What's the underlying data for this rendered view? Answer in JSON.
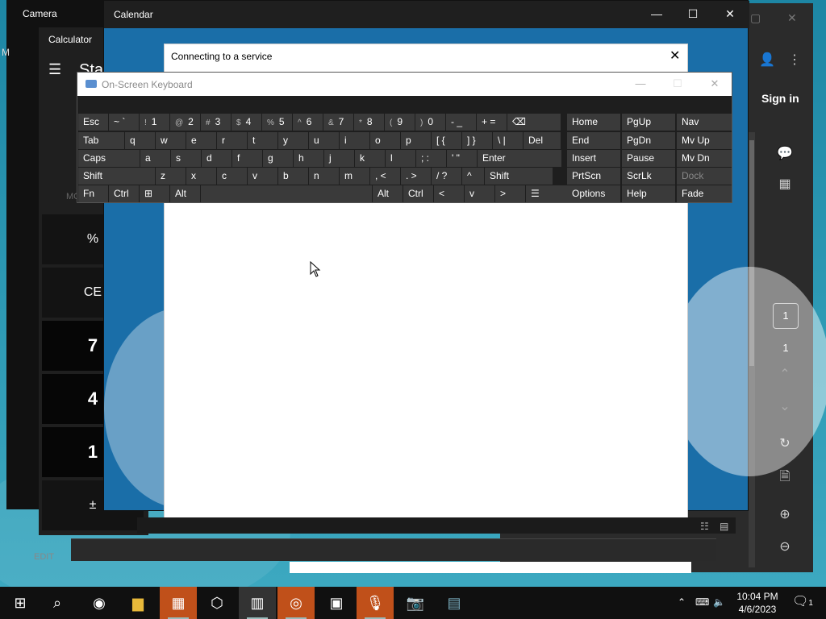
{
  "reader": {
    "sign_in": "Sign in",
    "page_box": "1",
    "page_num": "1"
  },
  "camera": {
    "title": "Camera",
    "letter": "M"
  },
  "calculator": {
    "title": "Calculator",
    "mode": "Sta",
    "mem_label": "MC",
    "keys": [
      "%",
      "CE",
      "7",
      "4",
      "1",
      "±"
    ],
    "edit_label": "EDIT"
  },
  "calendar": {
    "title": "Calendar"
  },
  "dialog": {
    "title": "Connecting to a service"
  },
  "osk": {
    "title": "On-Screen Keyboard",
    "row1": [
      {
        "l": "Esc"
      },
      {
        "l": "~ `"
      },
      {
        "s": "!",
        "l": "1"
      },
      {
        "s": "@",
        "l": "2"
      },
      {
        "s": "#",
        "l": "3"
      },
      {
        "s": "$",
        "l": "4"
      },
      {
        "s": "%",
        "l": "5"
      },
      {
        "s": "^",
        "l": "6"
      },
      {
        "s": "&",
        "l": "7"
      },
      {
        "s": "*",
        "l": "8"
      },
      {
        "s": "(",
        "l": "9"
      },
      {
        "s": ")",
        "l": "0"
      },
      {
        "l": "- _"
      },
      {
        "l": "+ ="
      },
      {
        "l": "⌫"
      }
    ],
    "row2": [
      "Tab",
      "q",
      "w",
      "e",
      "r",
      "t",
      "y",
      "u",
      "i",
      "o",
      "p",
      "[ {",
      "] }",
      "\\ |",
      "Del"
    ],
    "row3": [
      "Caps",
      "a",
      "s",
      "d",
      "f",
      "g",
      "h",
      "j",
      "k",
      "l",
      "; :",
      "' \"",
      "Enter"
    ],
    "row4": [
      "Shift",
      "z",
      "x",
      "c",
      "v",
      "b",
      "n",
      "m",
      ", <",
      ". >",
      "/ ?",
      "^",
      "Shift"
    ],
    "row5": [
      "Fn",
      "Ctrl",
      "⊞",
      "Alt",
      "",
      "Alt",
      "Ctrl",
      "<",
      "v",
      ">",
      "☰"
    ],
    "nav": [
      [
        "Home",
        "PgUp",
        "Nav"
      ],
      [
        "End",
        "PgDn",
        "Mv Up"
      ],
      [
        "Insert",
        "Pause",
        "Mv Dn"
      ],
      [
        "PrtScn",
        "ScrLk",
        "Dock"
      ],
      [
        "Options",
        "Help",
        "Fade"
      ]
    ]
  },
  "taskbar": {
    "time": "10:04 PM",
    "date": "4/6/2023",
    "notif_count": "1"
  }
}
